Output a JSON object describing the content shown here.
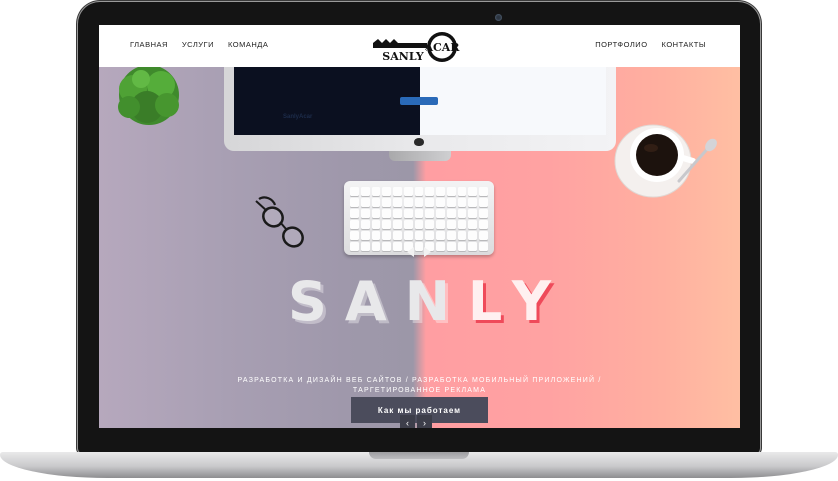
{
  "nav": {
    "left_items": [
      "ГЛАВНАЯ",
      "УСЛУГИ",
      "КОМАНДА"
    ],
    "right_items": [
      "ПОРТФОЛИО",
      "КОНТАКТЫ"
    ],
    "logo_text_main": "SANLY",
    "logo_text_accent": "ACAR"
  },
  "monitor_site": {
    "title": "SanlyAcar"
  },
  "hero": {
    "title_part1": "SA",
    "title_part2": "N",
    "title_part3": "L",
    "title_part4": "Y",
    "subtitle_line1": "РАЗРАБОТКА И ДИЗАЙН ВЕБ САЙТОВ / РАЗРАБОТКА МОБИЛЬНЫЙ ПРИЛОЖЕНИЙ /",
    "subtitle_line2": "ТАРГЕТИРОВАННОЕ РЕКЛАМА",
    "cta_label": "Как мы работаем"
  },
  "slider": {
    "prev_icon": "chevron-left-icon",
    "next_icon": "chevron-right-icon",
    "prev_glyph": "‹",
    "next_glyph": "›"
  },
  "colors": {
    "hero_left": "#9c97a8",
    "hero_right": "#ffa2a2",
    "cta_bg": "#4b4c5c",
    "accent_red": "#ef4a5a"
  }
}
